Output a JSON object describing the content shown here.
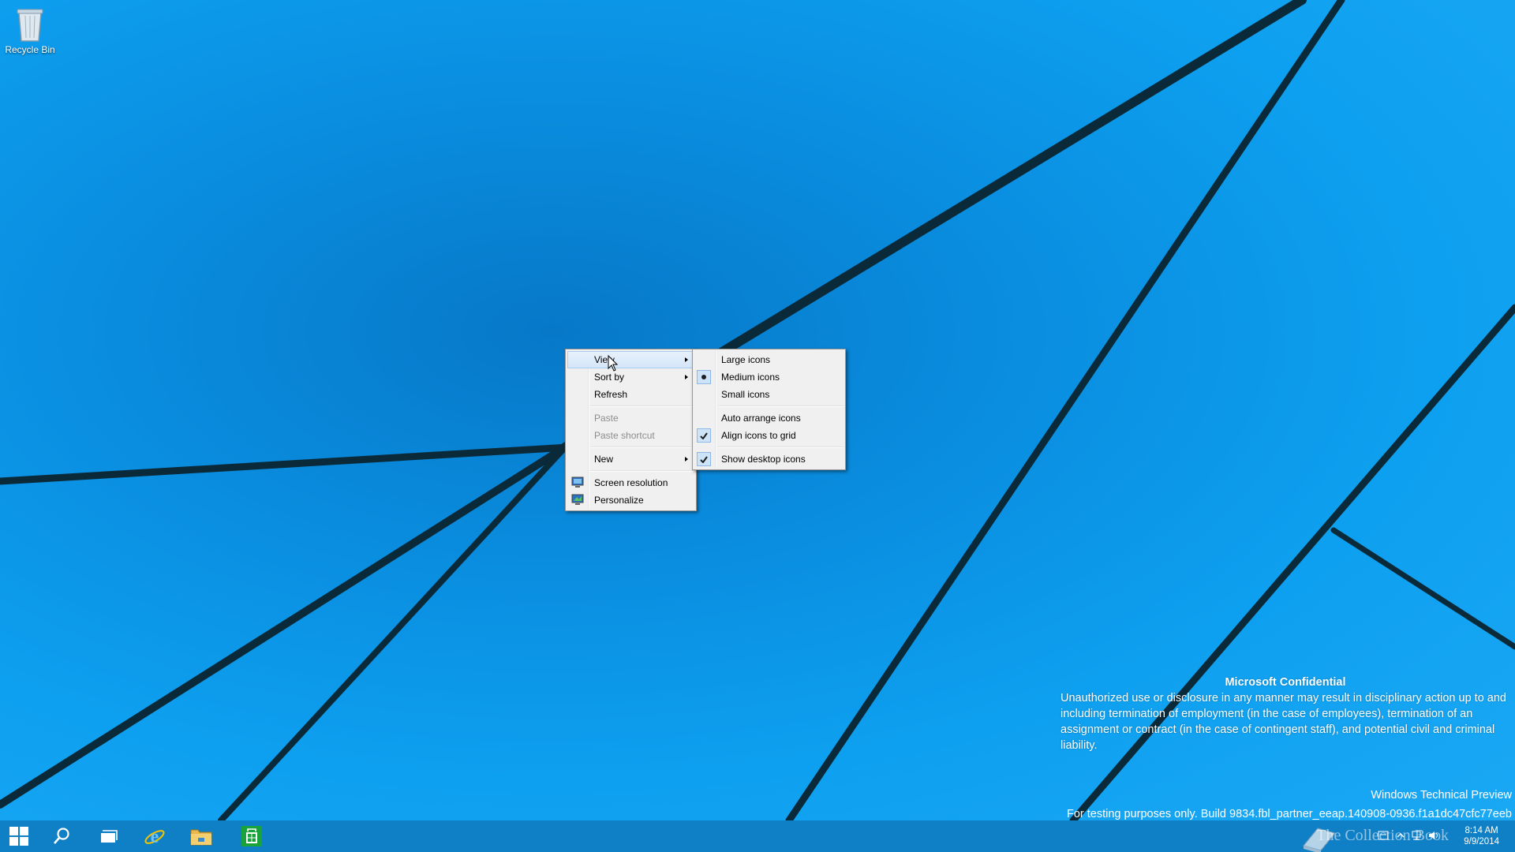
{
  "desktop": {
    "icons": [
      {
        "label": "Recycle Bin",
        "icon": "recycle-bin-icon"
      }
    ]
  },
  "context_menu": {
    "items": [
      {
        "label": "View",
        "has_submenu": true,
        "state": "highlighted"
      },
      {
        "label": "Sort by",
        "has_submenu": true
      },
      {
        "label": "Refresh"
      },
      {
        "label": "Paste",
        "disabled": true
      },
      {
        "label": "Paste shortcut",
        "disabled": true
      },
      {
        "label": "New",
        "has_submenu": true
      },
      {
        "label": "Screen resolution",
        "icon": "screen-resolution-icon"
      },
      {
        "label": "Personalize",
        "icon": "personalize-icon"
      }
    ]
  },
  "view_submenu": {
    "items": [
      {
        "label": "Large icons"
      },
      {
        "label": "Medium icons",
        "mark": "radio-selected"
      },
      {
        "label": "Small icons"
      },
      {
        "label": "Auto arrange icons"
      },
      {
        "label": "Align icons to grid",
        "mark": "checked"
      },
      {
        "label": "Show desktop icons",
        "mark": "checked"
      }
    ]
  },
  "watermark": {
    "title": "Microsoft Confidential",
    "body": "Unauthorized use or disclosure in any manner may result in disciplinary action up to and including termination of employment (in the case of employees), termination of an assignment or contract (in the case of contingent staff), and potential civil and criminal liability.",
    "edition": "Windows Technical Preview",
    "build": "For testing purposes only. Build 9834.fbl_partner_eeap.140908-0936.f1a1dc47cfc77eeb"
  },
  "taskbar": {
    "buttons": [
      "start-icon",
      "search-icon",
      "task-view-icon",
      "internet-explorer-icon",
      "file-explorer-icon",
      "store-icon"
    ],
    "overlay_text": "The Collection Book",
    "clock": {
      "time": "8:14 AM",
      "date": "9/9/2014"
    }
  },
  "colors": {
    "desktop_blue": "#0a8fe0",
    "taskbar": "#0f7fc6",
    "menu_background": "#f0f0f0",
    "highlight": "#d4e5f8"
  }
}
